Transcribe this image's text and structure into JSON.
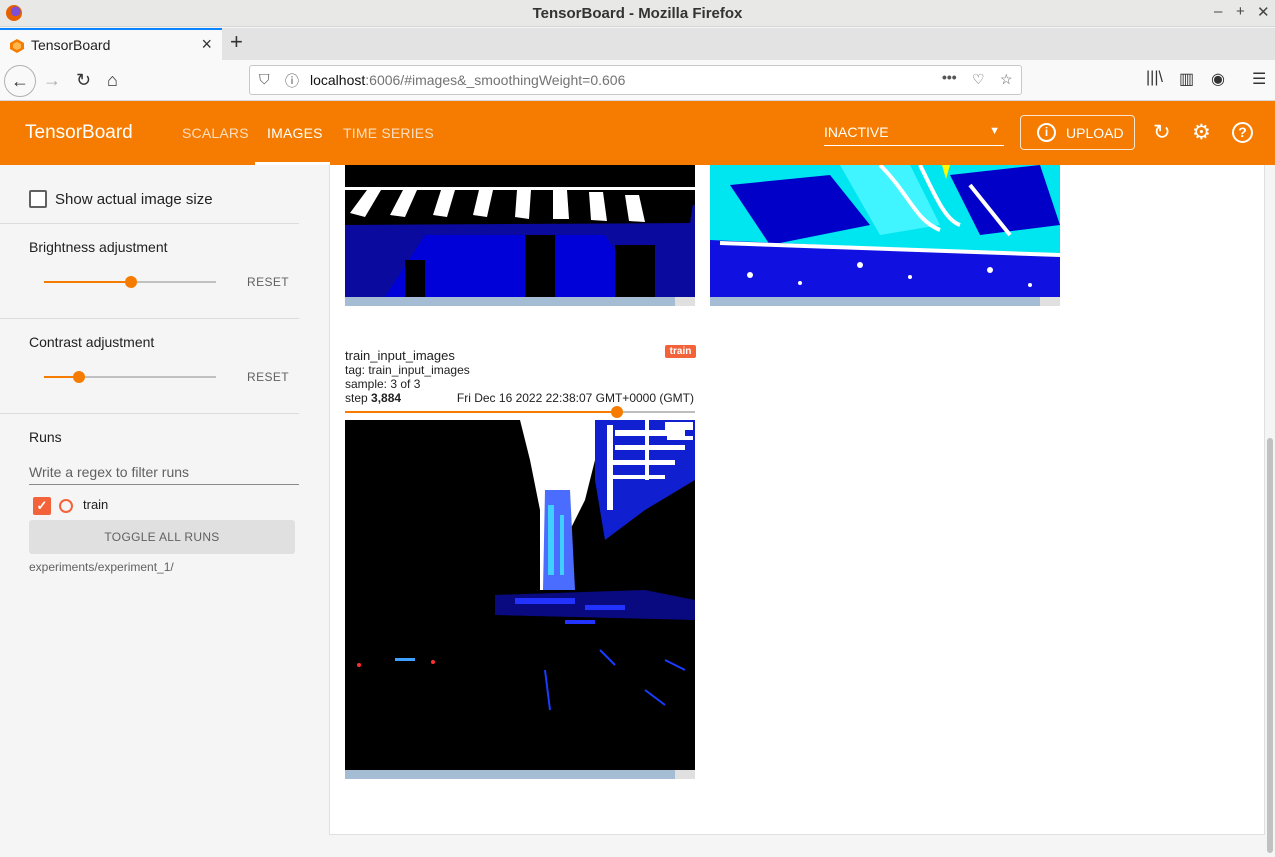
{
  "browser": {
    "window_title": "TensorBoard - Mozilla Firefox",
    "tab_title": "TensorBoard",
    "url_host": "localhost",
    "url_rest": ":6006/#images&_smoothingWeight=0.606"
  },
  "header": {
    "brand": "TensorBoard",
    "tabs": [
      "SCALARS",
      "IMAGES",
      "TIME SERIES"
    ],
    "active_tab": "IMAGES",
    "run_selector": "INACTIVE",
    "upload_label": "UPLOAD"
  },
  "sidebar": {
    "show_actual_size": "Show actual image size",
    "brightness": {
      "label": "Brightness adjustment",
      "value": 0.5,
      "reset": "RESET"
    },
    "contrast": {
      "label": "Contrast adjustment",
      "value": 0.2,
      "reset": "RESET"
    },
    "runs_title": "Runs",
    "filter_placeholder": "Write a regex to filter runs",
    "runs": [
      {
        "name": "train",
        "checked": true,
        "color": "#f4623a"
      }
    ],
    "toggle_all": "TOGGLE ALL RUNS",
    "logdir": "experiments/experiment_1/"
  },
  "card": {
    "title": "train_input_images",
    "run_chip": "train",
    "tag": "tag: train_input_images",
    "sample": "sample: 3 of 3",
    "step_label": "step",
    "step_value": "3,884",
    "date": "Fri Dec 16 2022 22:38:07 GMT+0000 (GMT)",
    "step_slider": 0.78
  },
  "colors": {
    "accent": "#f57c00",
    "run": "#f4623a"
  }
}
